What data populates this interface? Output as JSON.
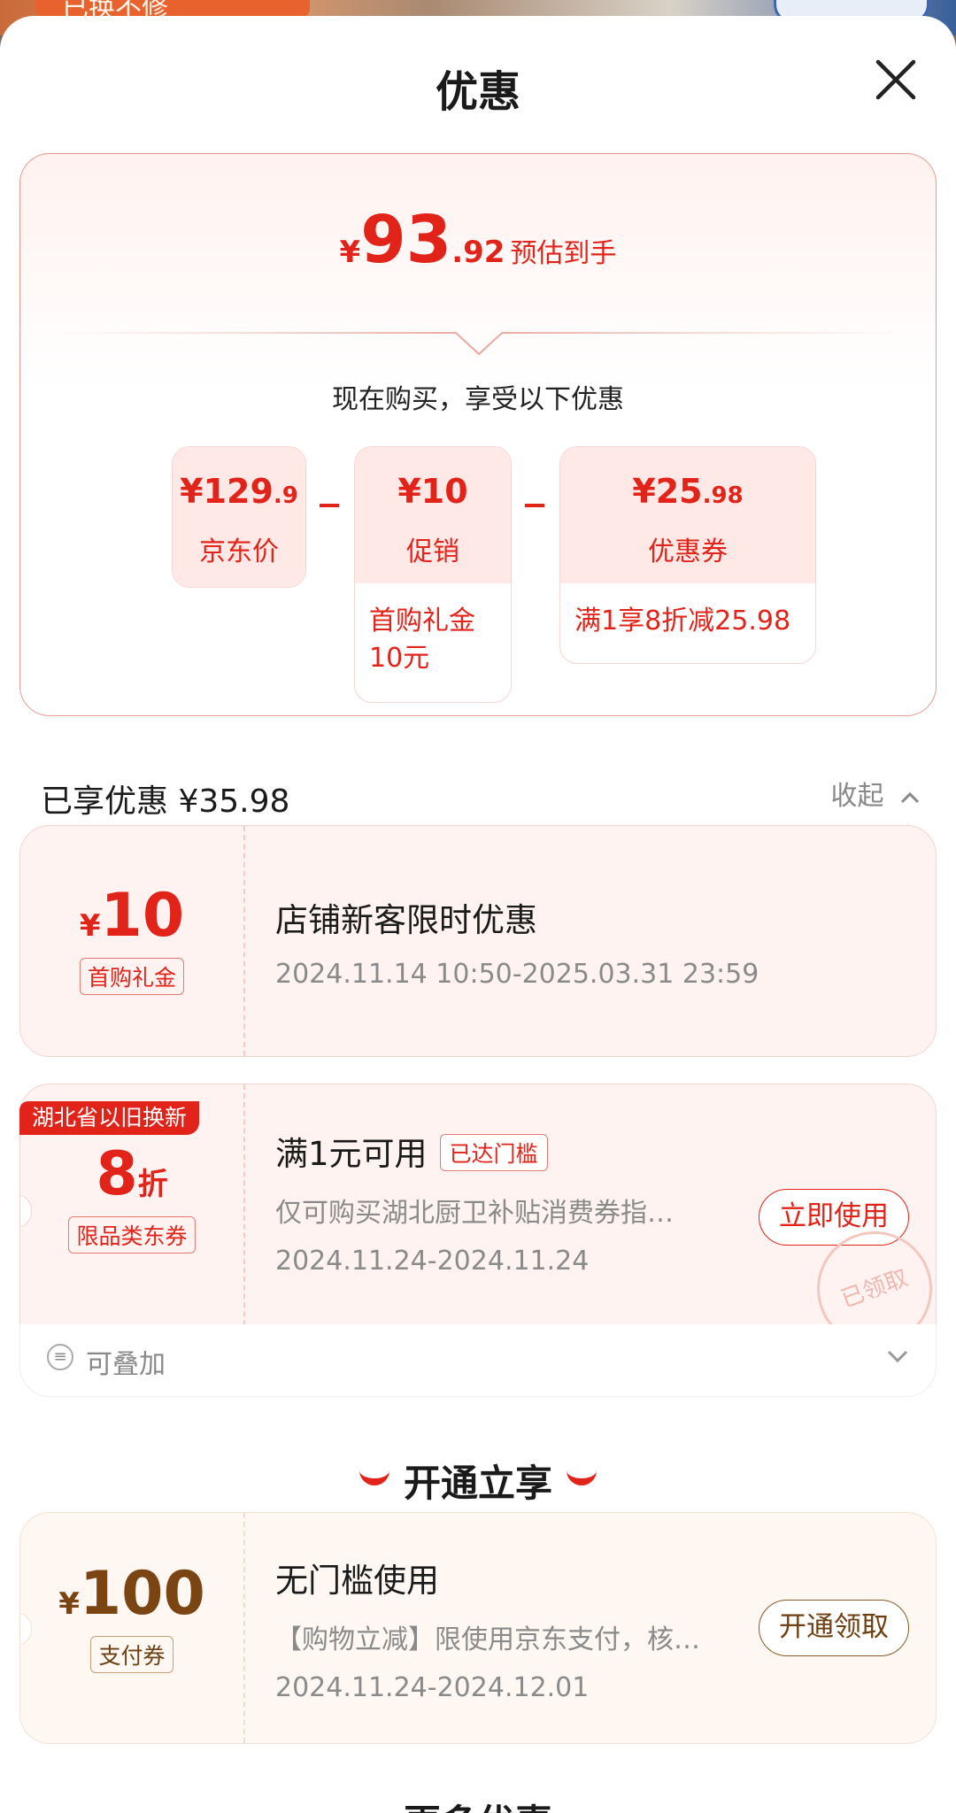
{
  "header": {
    "title": "优惠"
  },
  "summary": {
    "currency": "¥",
    "price_int": "93",
    "price_dec": ".92",
    "price_label": "预估到手",
    "enjoy_text": "现在购买，享受以下优惠",
    "formula": [
      {
        "amount_main": "¥129",
        "amount_small": ".9",
        "caption": "京东价",
        "detail": ""
      },
      {
        "amount_main": "¥10",
        "amount_small": "",
        "caption": "促销",
        "detail": "首购礼金10元"
      },
      {
        "amount_main": "¥25",
        "amount_small": ".98",
        "caption": "优惠券",
        "detail": "满1享8折减25.98"
      }
    ]
  },
  "savings": {
    "label": "已享优惠 ¥35.98",
    "collapse_label": "收起"
  },
  "coupons": [
    {
      "currency": "¥",
      "amount": "10",
      "unit": "",
      "tag": "首购礼金",
      "title": "店铺新客限时优惠",
      "desc": "",
      "date": "2024.11.14 10:50-2025.03.31 23:59"
    },
    {
      "ribbon": "湖北省以旧换新",
      "currency": "",
      "amount": "8",
      "unit": "折",
      "tag": "限品类东券",
      "title": "满1元可用",
      "badge": "已达门槛",
      "desc": "仅可购买湖北厨卫补贴消费券指…",
      "date": "2024.11.24-2024.11.24",
      "button": "立即使用",
      "stamp": "已领取",
      "stack_label": "可叠加"
    }
  ],
  "open_section": {
    "title": "开通立享"
  },
  "pay_coupon": {
    "currency": "¥",
    "amount": "100",
    "tag": "支付券",
    "title": "无门槛使用",
    "desc": "【购物立减】限使用京东支付，核…",
    "date": "2024.11.24-2024.12.01",
    "button": "开通领取"
  },
  "more_section": {
    "title": "更多优惠"
  },
  "background": {
    "badge": "已换不修"
  },
  "colors": {
    "accent": "#e2231a",
    "gold": "#7a4512"
  }
}
